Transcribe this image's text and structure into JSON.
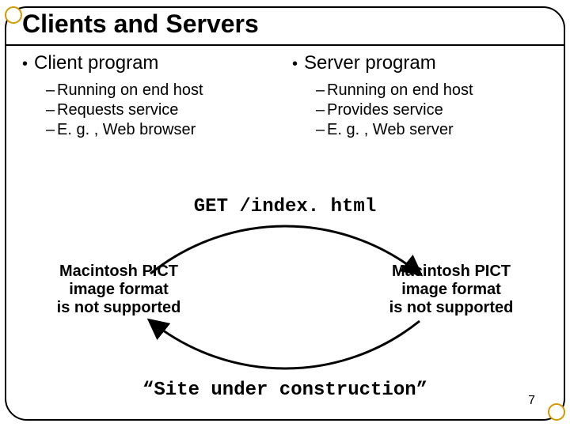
{
  "title": "Clients and Servers",
  "left": {
    "heading": "Client program",
    "items": [
      "Running on end host",
      "Requests service",
      "E. g. , Web browser"
    ]
  },
  "right": {
    "heading": "Server program",
    "items": [
      "Running on end host",
      "Provides service",
      "E. g. , Web server"
    ]
  },
  "code_top": "GET /index. html",
  "code_bottom": "“Site under construction”",
  "pict_lines": [
    "Macintosh PICT",
    "image format",
    "is not supported"
  ],
  "page_number": "7"
}
